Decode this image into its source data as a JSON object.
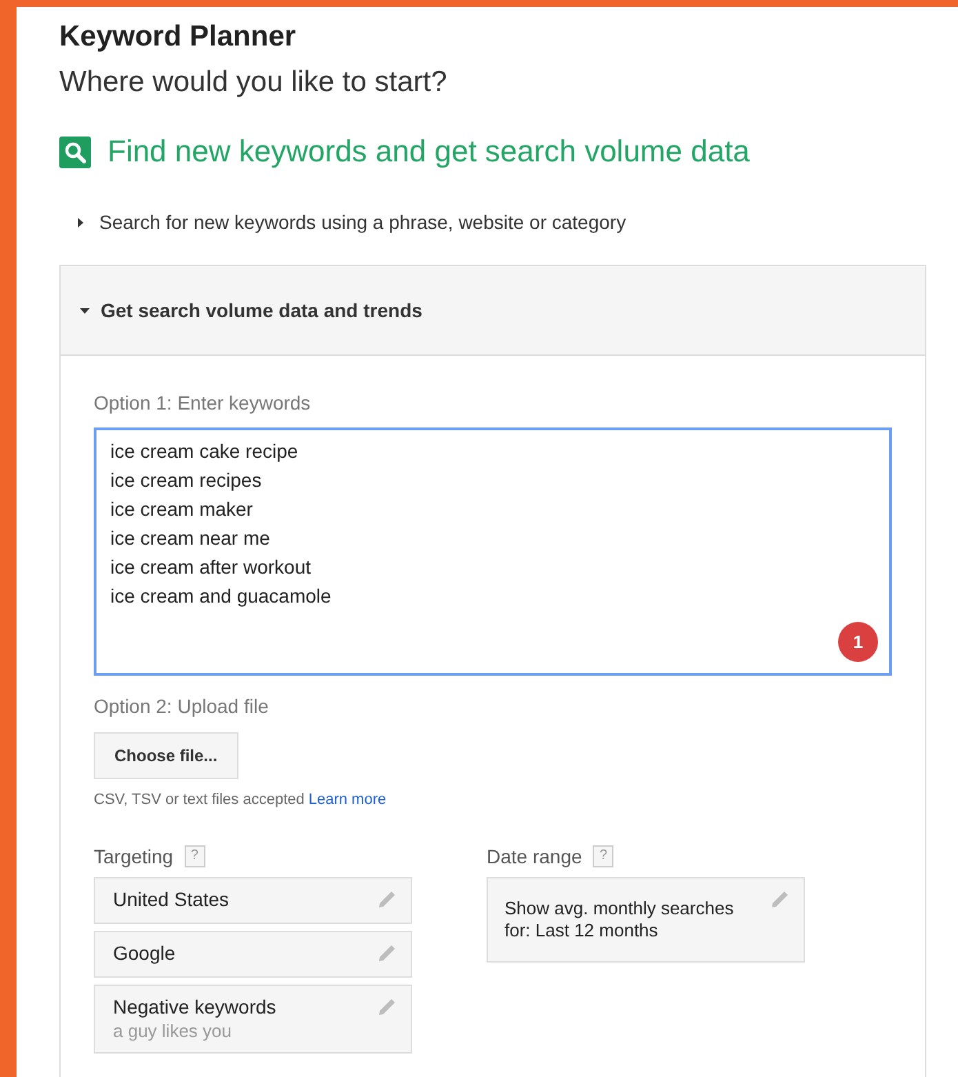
{
  "title": "Keyword Planner",
  "subtitle": "Where would you like to start?",
  "heading": "Find new keywords and get search volume data",
  "sections": [
    {
      "label": "Search for new keywords using a phrase, website or category",
      "expanded": false
    },
    {
      "label": "Get search volume data and trends",
      "expanded": true
    }
  ],
  "option1": {
    "label": "Option 1: Enter keywords",
    "keywords": [
      "ice cream cake recipe",
      "ice cream recipes",
      "ice cream maker",
      "ice cream near me",
      "ice cream after workout",
      "ice cream and guacamole"
    ],
    "badge": "1"
  },
  "option2": {
    "label": "Option 2: Upload file",
    "button": "Choose file...",
    "hint": "CSV, TSV or text files accepted",
    "link": "Learn more"
  },
  "targeting": {
    "label": "Targeting",
    "help": "?",
    "items": [
      {
        "title": "United States"
      },
      {
        "title": "Google"
      },
      {
        "title": "Negative keywords",
        "detail": "a guy likes you"
      }
    ]
  },
  "date_range": {
    "label": "Date range",
    "help": "?",
    "text": "Show avg. monthly searches for: Last 12 months"
  }
}
